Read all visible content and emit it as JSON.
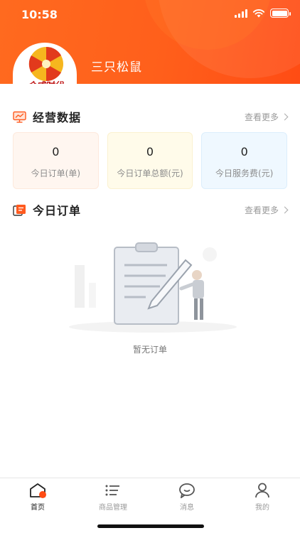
{
  "status_bar": {
    "time": "10:58"
  },
  "header": {
    "user_name": "三只松鼠",
    "logo_text": "合成时代"
  },
  "business": {
    "title": "经营数据",
    "more_label": "查看更多",
    "stats": [
      {
        "value": "0",
        "label": "今日订单(单)"
      },
      {
        "value": "0",
        "label": "今日订单总额(元)"
      },
      {
        "value": "0",
        "label": "今日服务费(元)"
      }
    ]
  },
  "orders": {
    "title": "今日订单",
    "more_label": "查看更多",
    "empty_text": "暂无订单"
  },
  "tabbar": {
    "tabs": [
      {
        "label": "首页",
        "icon": "home-icon",
        "active": true
      },
      {
        "label": "商品管理",
        "icon": "list-icon",
        "active": false
      },
      {
        "label": "消息",
        "icon": "message-icon",
        "active": false
      },
      {
        "label": "我的",
        "icon": "user-icon",
        "active": false
      }
    ]
  },
  "colors": {
    "brand": "#ff5f1b",
    "tab_active_accent": "#ff4c14"
  }
}
